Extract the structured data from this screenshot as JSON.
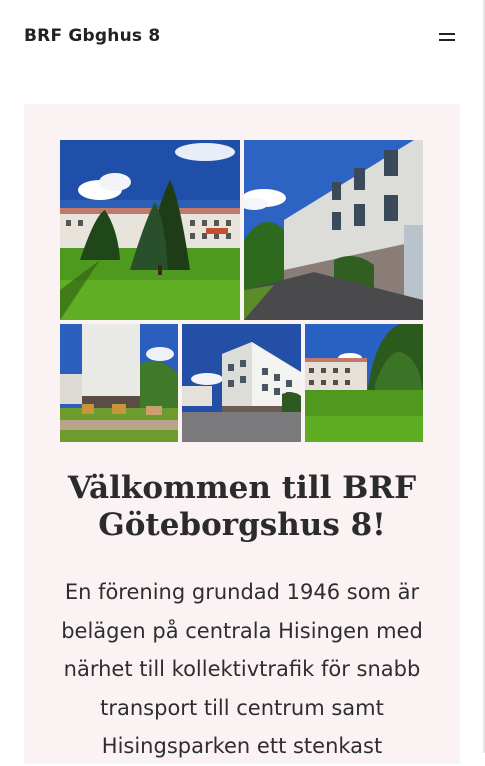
{
  "header": {
    "site_title": "BRF Gbghus 8",
    "menu_icon": "hamburger-menu-icon"
  },
  "gallery": {
    "photos": [
      {
        "subject": "courtyard-with-trees"
      },
      {
        "subject": "building-side-alley"
      },
      {
        "subject": "building-with-scaffolding"
      },
      {
        "subject": "white-apartment-block"
      },
      {
        "subject": "lawn-and-buildings"
      }
    ]
  },
  "hero": {
    "heading": "Välkommen till BRF Göteborgshus 8!",
    "intro": "En förening grundad 1946 som är belägen på centrala Hisingen med närhet till kollektivtrafik för snabb transport till centrum samt Hisingsparken ett stenkast"
  },
  "colors": {
    "card_background": "#fbf3f3",
    "text": "#2b2b2b"
  }
}
